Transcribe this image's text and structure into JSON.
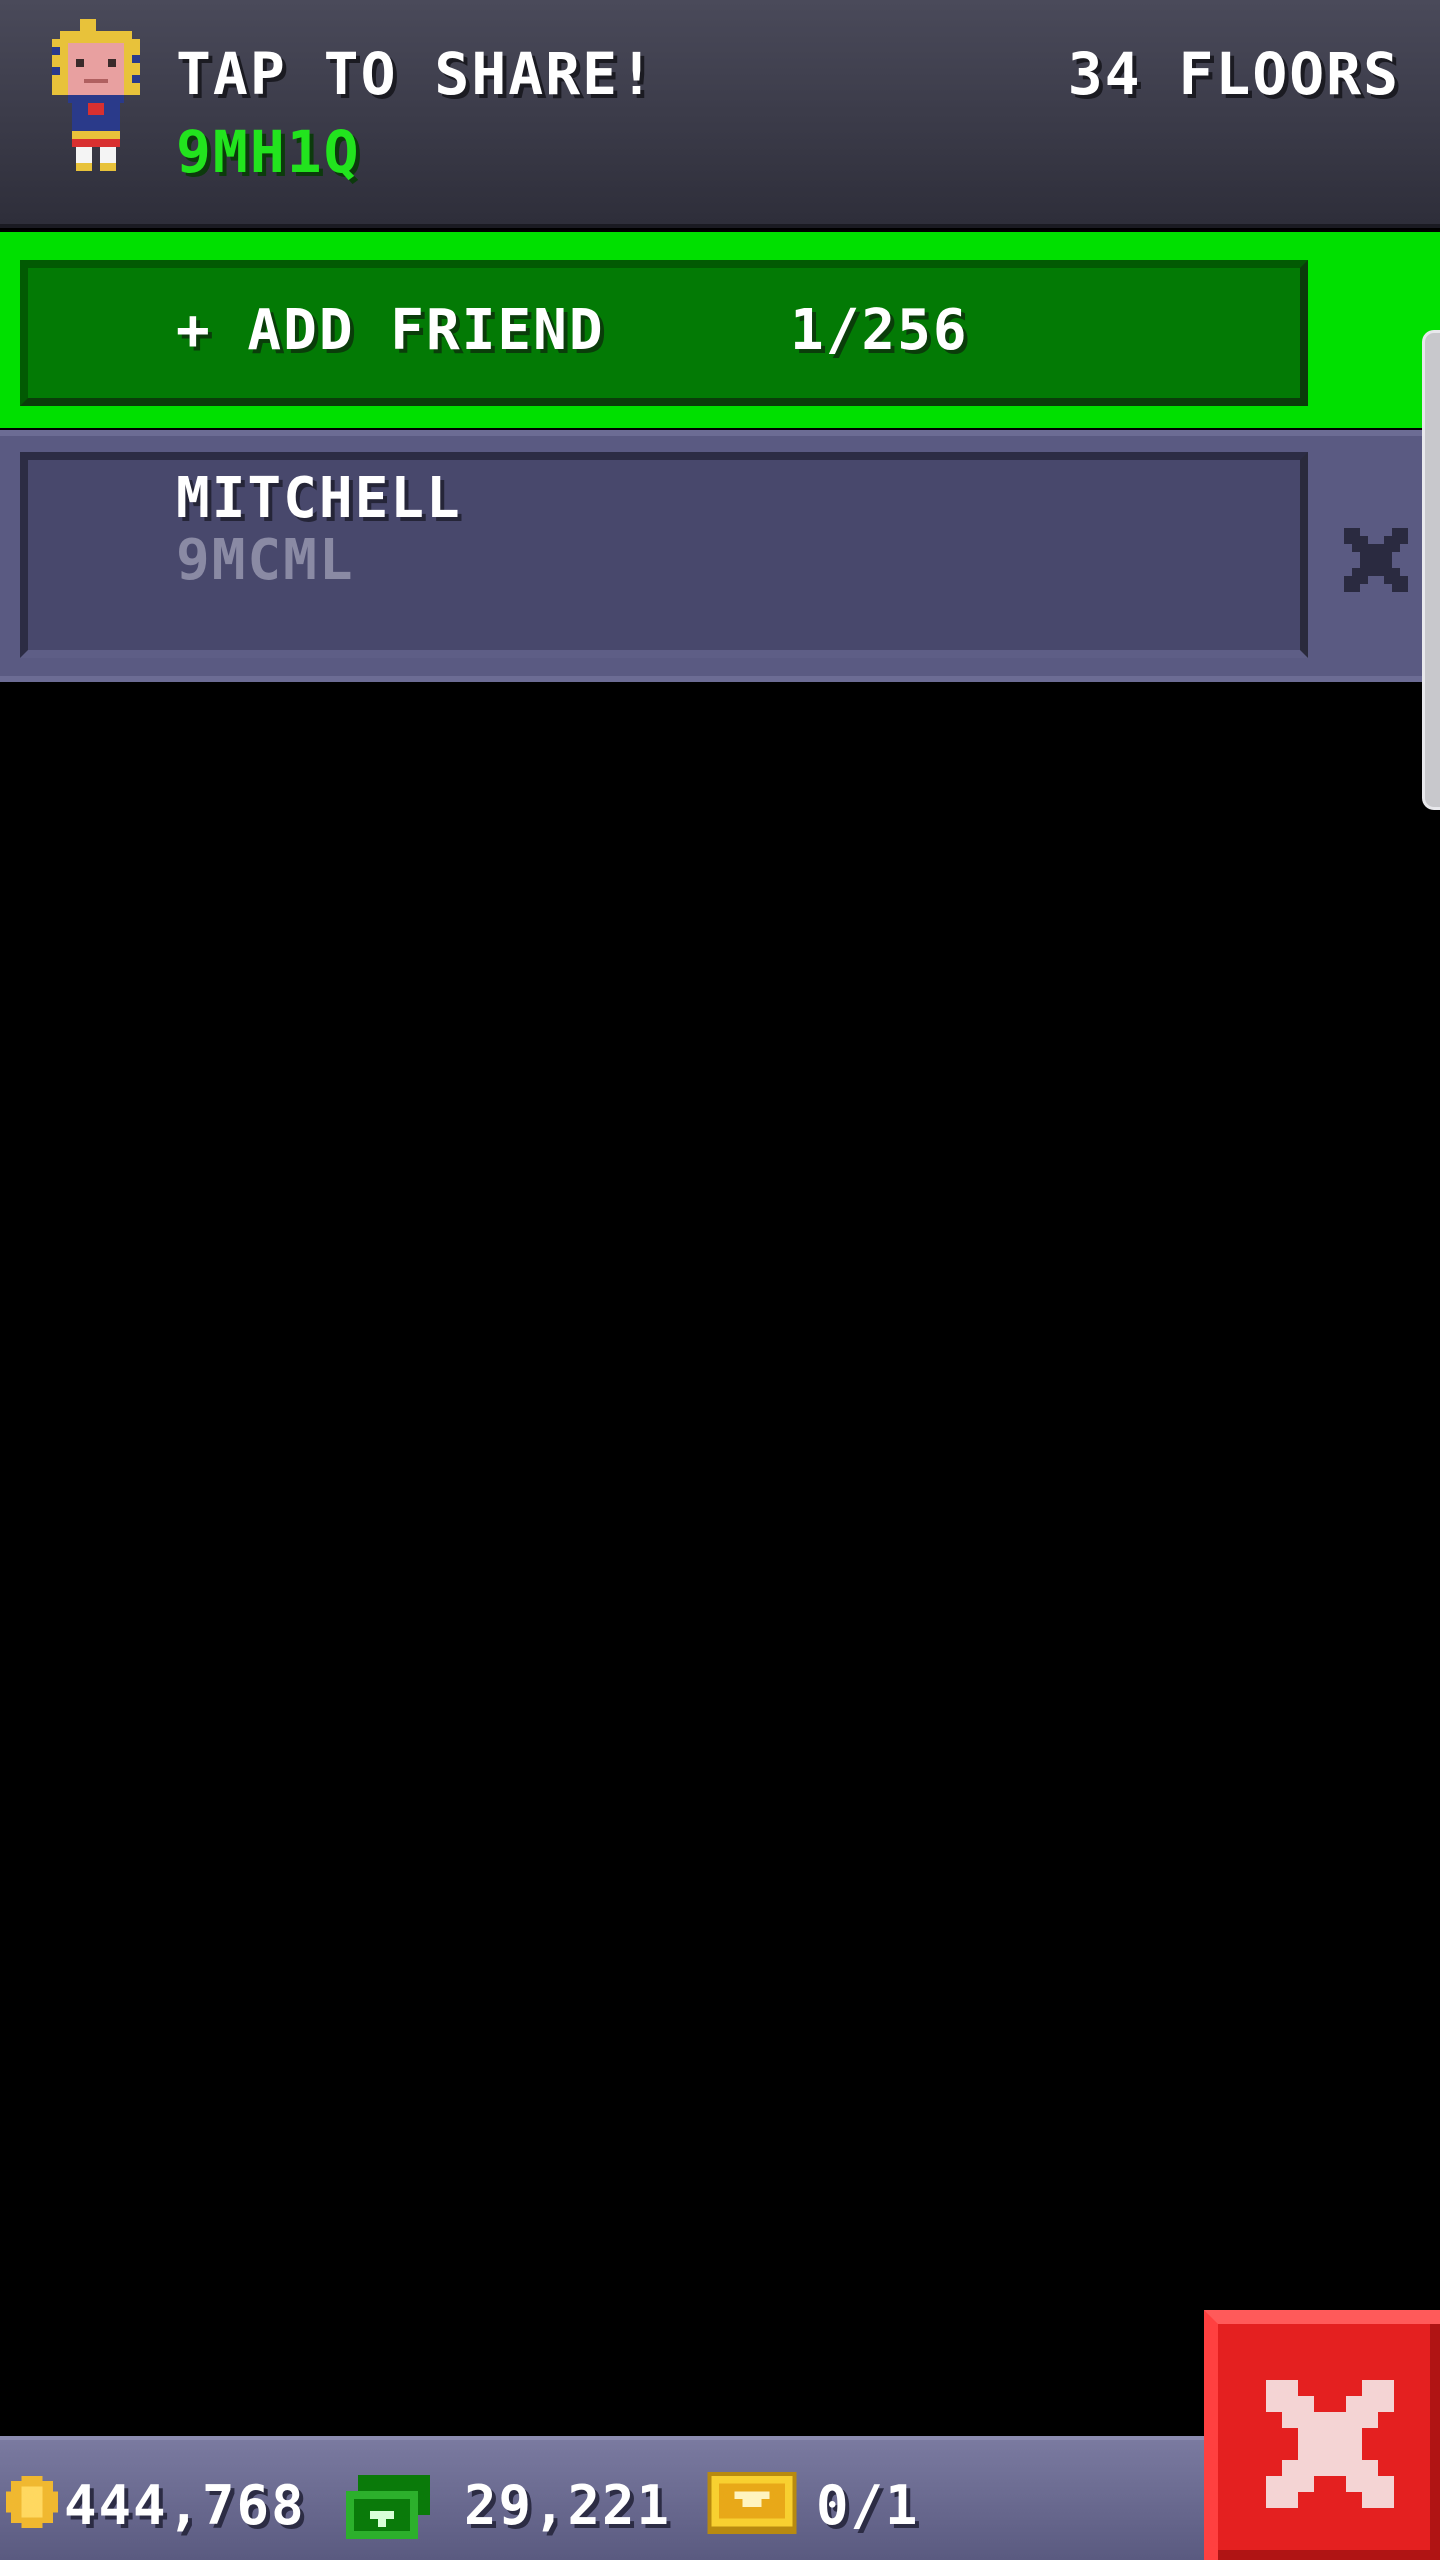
{
  "header": {
    "share_title": "TAP TO SHARE!",
    "player_code": "9MH1Q",
    "floors": "34 FLOORS"
  },
  "add_friend": {
    "label": "+ ADD FRIEND",
    "count": "1/256"
  },
  "friends": [
    {
      "name": "MITCHELL",
      "code": "9MCML"
    }
  ],
  "footer": {
    "coins": "444,768",
    "bux": "29,221",
    "tickets": "0/1"
  },
  "colors": {
    "accent_green": "#00e000",
    "button_green": "#037a05",
    "code_green": "#22e41e",
    "close_red": "#e42020",
    "panel_purple": "#48486c"
  },
  "icons": {
    "avatar": "pharaoh-avatar-icon",
    "remove": "close-icon",
    "coin": "coin-icon",
    "bux": "bux-banknote-icon",
    "ticket": "vip-ticket-icon",
    "close": "close-icon"
  }
}
